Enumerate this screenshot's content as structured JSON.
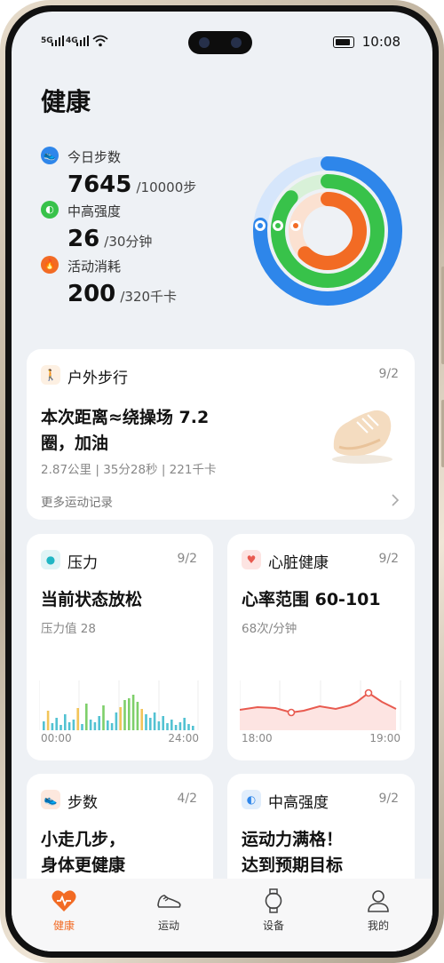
{
  "status_bar": {
    "signal1": "5G",
    "signal2": "4G",
    "time": "10:08"
  },
  "page_title": "健康",
  "metrics": [
    {
      "label": "今日步数",
      "value": "7645",
      "goal": "/10000步",
      "color": "#2e86ea",
      "icon": "walking-icon"
    },
    {
      "label": "中高强度",
      "value": "26",
      "goal": "/30分钟",
      "color": "#38c24a",
      "icon": "intensity-icon"
    },
    {
      "label": "活动消耗",
      "value": "200",
      "goal": "/320千卡",
      "color": "#f26b24",
      "icon": "flame-icon"
    }
  ],
  "rings": {
    "steps_progress": 0.7645,
    "intensity_progress": 0.867,
    "calories_progress": 0.625
  },
  "walk_card": {
    "title": "户外步行",
    "date": "9/2",
    "message_line1": "本次距离≈绕操场 7.2",
    "message_line2": "圈，加油",
    "stats": "2.87公里 | 35分28秒 | 221千卡",
    "more": "更多运动记录"
  },
  "stress_card": {
    "title": "压力",
    "date": "9/2",
    "status": "当前状态放松",
    "sub": "压力值 28",
    "x_start": "00:00",
    "x_end": "24:00"
  },
  "heart_card": {
    "title": "心脏健康",
    "date": "9/2",
    "status": "心率范围 60-101",
    "sub": "68次/分钟",
    "x_start": "18:00",
    "x_end": "19:00"
  },
  "steps_card": {
    "title": "步数",
    "date": "4/2",
    "line1": "小走几步，",
    "line2": "身体更健康"
  },
  "intensity_card": {
    "title": "中高强度",
    "date": "9/2",
    "line1": "运动力满格！",
    "line2": "达到预期目标"
  },
  "tabs": [
    {
      "label": "健康",
      "icon": "heart-icon",
      "active": true
    },
    {
      "label": "运动",
      "icon": "shoe-icon",
      "active": false
    },
    {
      "label": "设备",
      "icon": "watch-icon",
      "active": false
    },
    {
      "label": "我的",
      "icon": "profile-icon",
      "active": false
    }
  ],
  "colors": {
    "accent": "#f26b24",
    "steps": "#2e86ea",
    "intensity": "#38c24a",
    "calories": "#f26b24",
    "heart": "#e85a4f"
  }
}
